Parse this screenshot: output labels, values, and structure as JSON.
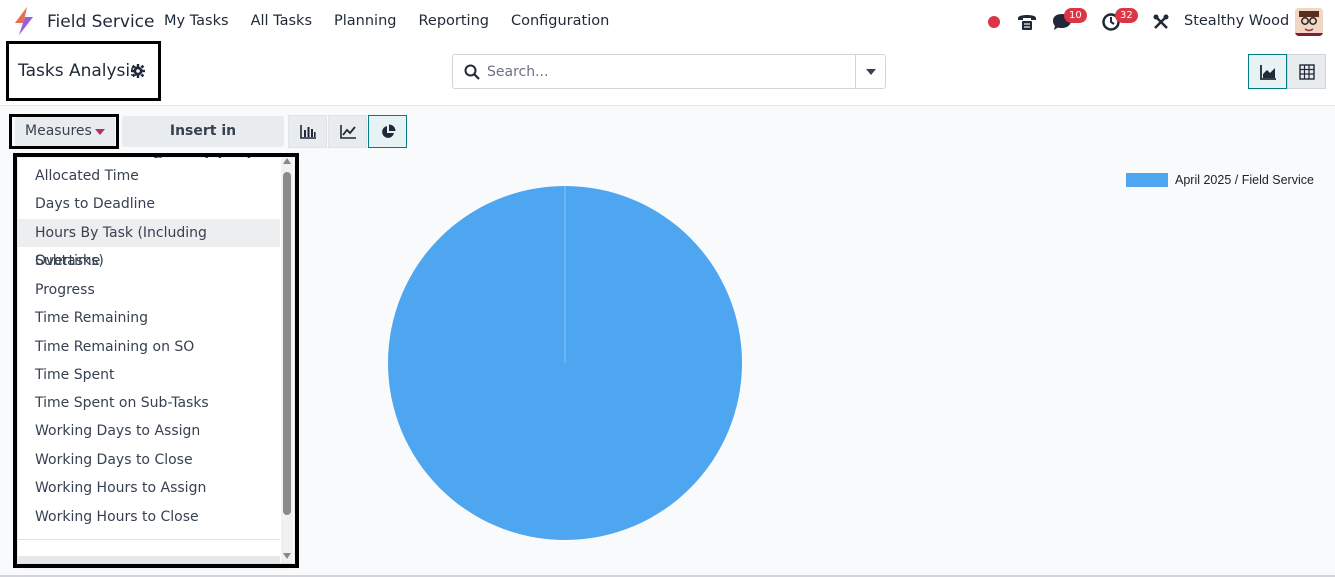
{
  "navbar": {
    "app_name": "Field Service",
    "menu": [
      "My Tasks",
      "All Tasks",
      "Planning",
      "Reporting",
      "Configuration"
    ],
    "chat_badge": "10",
    "activity_badge": "32",
    "user_name": "Stealthy Wood",
    "record_color": "#dc3545"
  },
  "control_panel": {
    "title": "Tasks Analysis",
    "search_placeholder": "Search..."
  },
  "toolbar": {
    "measures_label": "Measures",
    "insert_label": "Insert in Spreadsheet",
    "chart_types": [
      "bar-chart-icon",
      "line-chart-icon",
      "pie-chart-icon"
    ],
    "active_chart": "pie-chart-icon"
  },
  "measures_menu": {
    "items": [
      "Allocated Time",
      "Days to Deadline",
      "Hours By Task (Including Subtasks)",
      "Overtime",
      "Progress",
      "Time Remaining",
      "Time Remaining on SO",
      "Time Spent",
      "Time Spent on Sub-Tasks",
      "Working Days to Assign",
      "Working Days to Close",
      "Working Hours to Assign",
      "Working Hours to Close"
    ],
    "highlighted": "Hours By Task (Including Subtasks)"
  },
  "chart_data": {
    "type": "pie",
    "slices": [
      {
        "label": "April 2025 / Field Service",
        "value": 100,
        "color": "#4ea5f0"
      }
    ],
    "legend": [
      "April 2025 / Field Service"
    ],
    "legend_position": "top-right"
  },
  "colors": {
    "accent": "#017e84",
    "badge": "#dc3545",
    "pie": "#4ea5f0"
  }
}
